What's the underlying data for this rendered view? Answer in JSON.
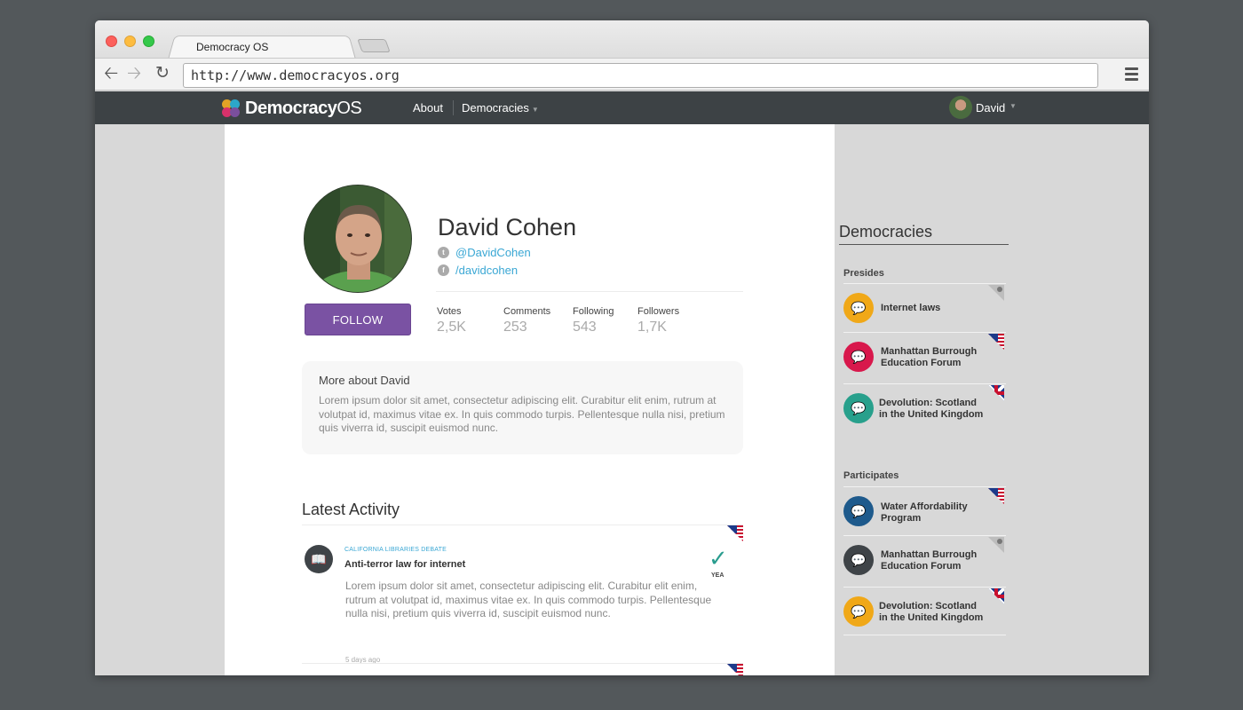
{
  "browser": {
    "tab_title": "Democracy OS",
    "url": "http://www.democracyos.org"
  },
  "site": {
    "logo_bold": "Democracy",
    "logo_light": "OS",
    "nav": {
      "about": "About",
      "democracies": "Democracies"
    },
    "user_name": "David"
  },
  "profile": {
    "name": "David Cohen",
    "twitter": "@DavidCohen",
    "facebook": "/davidcohen",
    "follow_label": "FOLLOW",
    "stats": [
      {
        "label": "Votes",
        "value": "2,5K"
      },
      {
        "label": "Comments",
        "value": "253"
      },
      {
        "label": "Following",
        "value": "543"
      },
      {
        "label": "Followers",
        "value": "1,7K"
      }
    ],
    "about_title": "More about David",
    "about_text": "Lorem ipsum dolor sit amet, consectetur adipiscing elit. Curabitur elit enim, rutrum at volutpat id, maximus vitae ex. In quis commodo turpis. Pellentesque nulla nisi, pretium quis viverra id, suscipit euismod nunc."
  },
  "activity": {
    "title": "Latest Activity",
    "items": [
      {
        "tag": "CALIFORNIA LIBRARIES DEBATE",
        "title": "Anti-terror law for internet",
        "text": "Lorem ipsum dolor sit amet, consectetur adipiscing elit. Curabitur elit enim, rutrum at volutpat id, maximus vitae ex. In quis commodo turpis. Pellentesque nulla nisi, pretium quis viverra id, suscipit euismod nunc.",
        "time": "5 days ago",
        "vote": "YEA",
        "flag": "us"
      }
    ]
  },
  "sidebar": {
    "title": "Democracies",
    "presides_label": "Presides",
    "participates_label": "Participates",
    "presides": [
      {
        "label": "Internet laws",
        "color": "#f0a818",
        "flag": "globe"
      },
      {
        "label": "Manhattan Burrough Education Forum",
        "color": "#d8184c",
        "flag": "us"
      },
      {
        "label": "Devolution: Scotland in the United Kingdom",
        "color": "#28a08c",
        "flag": "uk"
      }
    ],
    "participates": [
      {
        "label": "Water Affordability Program",
        "color": "#1e5a8c",
        "flag": "us"
      },
      {
        "label": "Manhattan Burrough Education Forum",
        "color": "#3f4448",
        "flag": "globe"
      },
      {
        "label": "Devolution: Scotland in the United Kingdom",
        "color": "#f0a818",
        "flag": "uk"
      }
    ]
  }
}
